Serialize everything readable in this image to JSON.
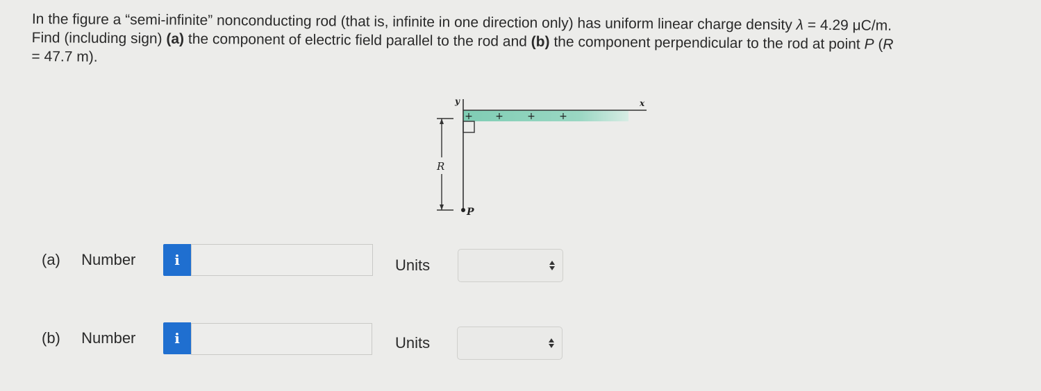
{
  "question": {
    "line1_a": "In the figure a “semi-infinite” nonconducting rod (that is, infinite in one direction only) has uniform linear charge density ",
    "lambda_symbol": "λ",
    "line1_b": " = 4.29 μC/m.",
    "line2_a": "Find (including sign) ",
    "part_a_tag": "(a)",
    "line2_b": " the component of electric field parallel to the rod and ",
    "part_b_tag": "(b)",
    "line2_c": " the component perpendicular to the rod at point ",
    "point_symbol": "P",
    "line2_d": " (",
    "r_symbol": "R",
    "line3": "= 47.7 m)."
  },
  "figure": {
    "y_label": "y",
    "x_label": "x",
    "r_label": "R",
    "p_label": "P",
    "charge_sign": "+",
    "rod_color": "#8fd3bd"
  },
  "answers": [
    {
      "tag": "(a)",
      "number_label": "Number",
      "info_icon": "i",
      "value": "",
      "units_label": "Units",
      "units_selected": ""
    },
    {
      "tag": "(b)",
      "number_label": "Number",
      "info_icon": "i",
      "value": "",
      "units_label": "Units",
      "units_selected": ""
    }
  ],
  "colors": {
    "info_button": "#1f6fd0",
    "background": "#ececea"
  }
}
